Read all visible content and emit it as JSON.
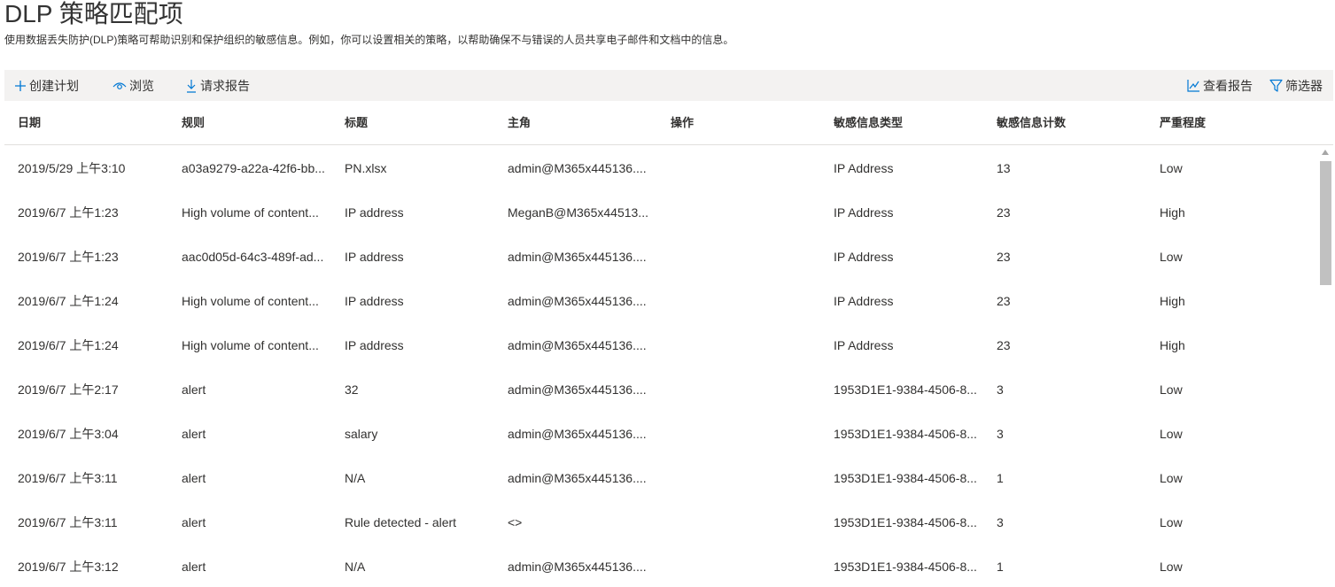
{
  "page": {
    "title": "DLP 策略匹配项",
    "description": "使用数据丢失防护(DLP)策略可帮助识别和保护组织的敏感信息。例如，你可以设置相关的策略，以帮助确保不与错误的人员共享电子邮件和文档中的信息。"
  },
  "toolbar": {
    "create_schedule": {
      "label": "创建计划",
      "icon": "plus-icon"
    },
    "view": {
      "label": "浏览",
      "icon": "eye-icon"
    },
    "request_report": {
      "label": "请求报告",
      "icon": "download-icon"
    },
    "view_report": {
      "label": "查看报告",
      "icon": "chart-line-icon"
    },
    "filter": {
      "label": "筛选器",
      "icon": "filter-icon"
    }
  },
  "table": {
    "columns": [
      "日期",
      "规则",
      "标题",
      "主角",
      "操作",
      "敏感信息类型",
      "敏感信息计数",
      "严重程度"
    ],
    "rows": [
      [
        "2019/5/29 上午3:10",
        "a03a9279-a22a-42f6-bb...",
        "PN.xlsx",
        "admin@M365x445136....",
        "",
        "IP Address",
        "13",
        "Low"
      ],
      [
        "2019/6/7 上午1:23",
        "High volume of content...",
        "IP address",
        "MeganB@M365x44513...",
        "",
        "IP Address",
        "23",
        "High"
      ],
      [
        "2019/6/7 上午1:23",
        "aac0d05d-64c3-489f-ad...",
        "IP address",
        "admin@M365x445136....",
        "",
        "IP Address",
        "23",
        "Low"
      ],
      [
        "2019/6/7 上午1:24",
        "High volume of content...",
        "IP address",
        "admin@M365x445136....",
        "",
        "IP Address",
        "23",
        "High"
      ],
      [
        "2019/6/7 上午1:24",
        "High volume of content...",
        "IP address",
        "admin@M365x445136....",
        "",
        "IP Address",
        "23",
        "High"
      ],
      [
        "2019/6/7 上午2:17",
        "alert",
        "32",
        "admin@M365x445136....",
        "",
        "1953D1E1-9384-4506-8...",
        "3",
        "Low"
      ],
      [
        "2019/6/7 上午3:04",
        "alert",
        "salary",
        "admin@M365x445136....",
        "",
        "1953D1E1-9384-4506-8...",
        "3",
        "Low"
      ],
      [
        "2019/6/7 上午3:11",
        "alert",
        "N/A",
        "admin@M365x445136....",
        "",
        "1953D1E1-9384-4506-8...",
        "1",
        "Low"
      ],
      [
        "2019/6/7 上午3:11",
        "alert",
        "Rule detected - alert",
        "<>",
        "",
        "1953D1E1-9384-4506-8...",
        "3",
        "Low"
      ],
      [
        "2019/6/7 上午3:12",
        "alert",
        "N/A",
        "admin@M365x445136....",
        "",
        "1953D1E1-9384-4506-8...",
        "1",
        "Low"
      ]
    ]
  },
  "colors": {
    "accent": "#0078d4",
    "toolbar_bg": "#f3f2f1",
    "text": "#323130"
  }
}
